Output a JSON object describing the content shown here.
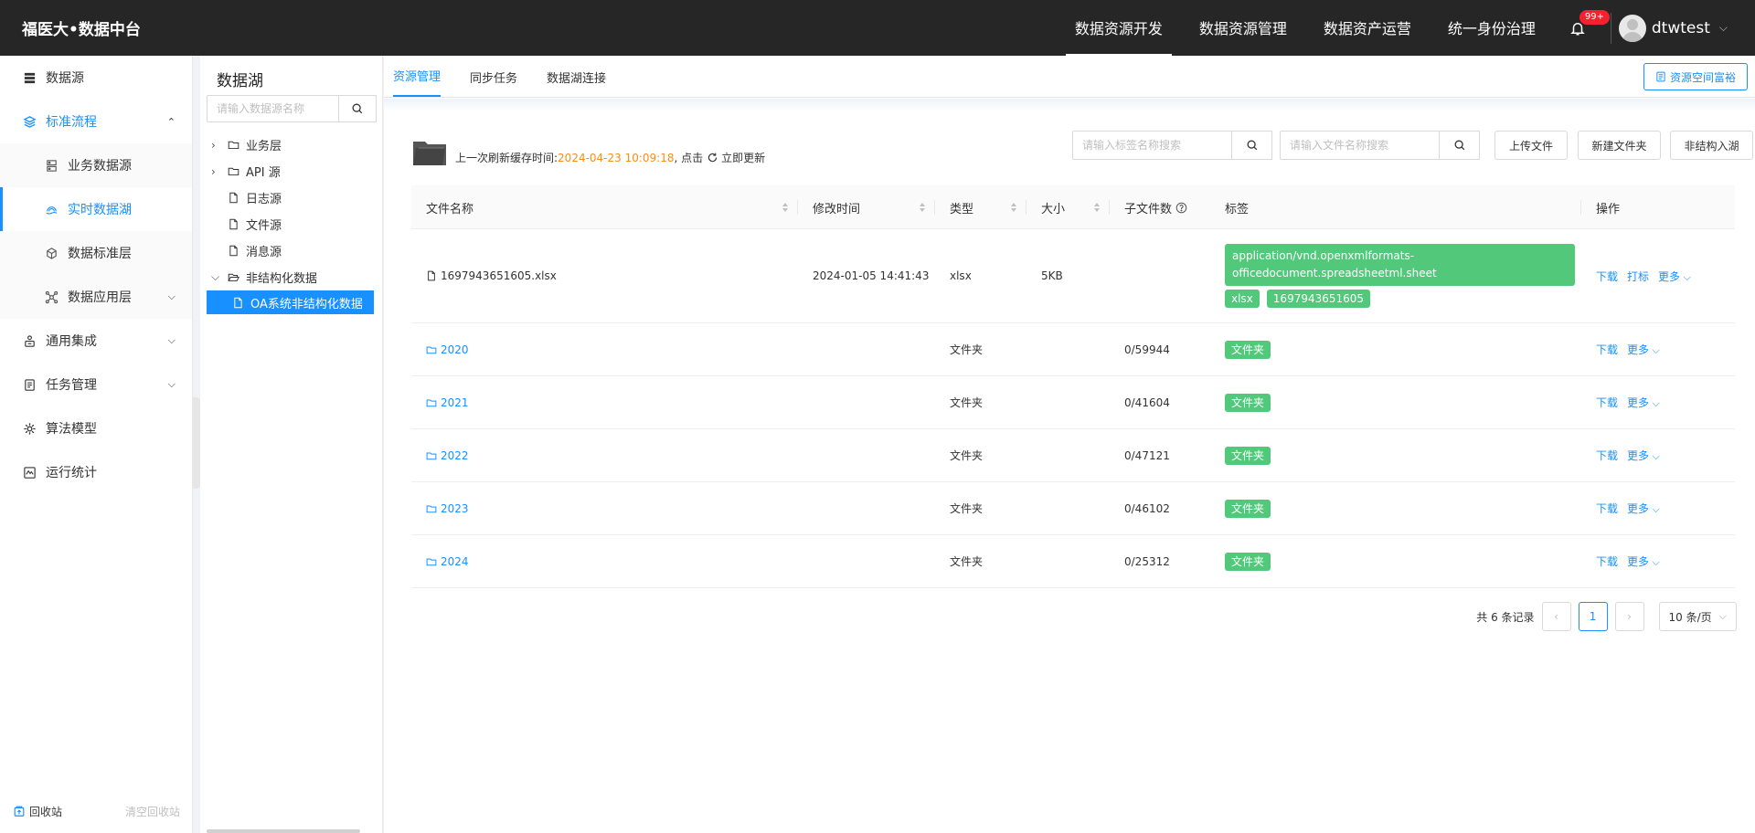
{
  "app": {
    "logo": "福医大•数据中台"
  },
  "topnav": {
    "items": [
      "数据资源开发",
      "数据资源管理",
      "数据资产运营",
      "统一身份治理"
    ],
    "active_index": 0,
    "notification_count": "99+",
    "username": "dtwtest"
  },
  "sidebar": {
    "items": [
      {
        "label": "数据源",
        "icon": "database-icon"
      },
      {
        "label": "标准流程",
        "icon": "layers-icon",
        "open": true
      },
      {
        "label": "业务数据源",
        "icon": "server-icon",
        "sub": true
      },
      {
        "label": "实时数据湖",
        "icon": "lake-icon",
        "sub": true,
        "selected": true
      },
      {
        "label": "数据标准层",
        "icon": "cube-icon",
        "sub": true
      },
      {
        "label": "数据应用层",
        "icon": "cluster-icon",
        "sub": true,
        "has_arrow": true
      },
      {
        "label": "通用集成",
        "icon": "integration-icon",
        "has_arrow": true
      },
      {
        "label": "任务管理",
        "icon": "task-icon",
        "has_arrow": true
      },
      {
        "label": "算法模型",
        "icon": "gear-icon"
      },
      {
        "label": "运行统计",
        "icon": "stats-icon"
      }
    ],
    "footer": {
      "recycle": "回收站",
      "clear": "清空回收站"
    }
  },
  "tree": {
    "title": "数据湖",
    "search_placeholder": "请输入数据源名称",
    "nodes": [
      {
        "label": "业务层",
        "type": "folder",
        "caret": "collapsed"
      },
      {
        "label": "API 源",
        "type": "folder",
        "caret": "collapsed"
      },
      {
        "label": "日志源",
        "type": "file"
      },
      {
        "label": "文件源",
        "type": "file"
      },
      {
        "label": "消息源",
        "type": "file"
      },
      {
        "label": "非结构化数据",
        "type": "folder-open",
        "caret": "expanded"
      },
      {
        "label": "OA系统非结构化数据",
        "type": "file",
        "child": true,
        "selected": true
      }
    ]
  },
  "tabs": {
    "items": [
      "资源管理",
      "同步任务",
      "数据湖连接"
    ],
    "active_index": 0,
    "rich_button": "资源空间富裕"
  },
  "toolbar": {
    "refresh_prefix": "上一次刷新缓存时间:",
    "refresh_time": "2024-04-23 10:09:18",
    "refresh_mid": ", 点击",
    "refresh_link": "立即更新",
    "tag_search_placeholder": "请输入标签名称搜索",
    "file_search_placeholder": "请输入文件名称搜索",
    "upload": "上传文件",
    "new_folder": "新建文件夹",
    "unstructured_in": "非结构入湖"
  },
  "table": {
    "columns": [
      "文件名称",
      "修改时间",
      "类型",
      "大小",
      "子文件数",
      "标签",
      "操作"
    ],
    "rows": [
      {
        "name": "1697943651605.xlsx",
        "kind": "file",
        "modified": "2024-01-05 14:41:43",
        "type": "xlsx",
        "size": "5KB",
        "children": "",
        "tags": [
          "application/vnd.openxmlformats-officedocument.spreadsheetml.sheet",
          "xlsx",
          "1697943651605"
        ],
        "ops": [
          "下载",
          "打标",
          "更多"
        ]
      },
      {
        "name": "2020",
        "kind": "folder",
        "modified": "",
        "type": "文件夹",
        "size": "",
        "children": "0/59944",
        "tags": [
          "文件夹"
        ],
        "ops": [
          "下载",
          "更多"
        ]
      },
      {
        "name": "2021",
        "kind": "folder",
        "modified": "",
        "type": "文件夹",
        "size": "",
        "children": "0/41604",
        "tags": [
          "文件夹"
        ],
        "ops": [
          "下载",
          "更多"
        ]
      },
      {
        "name": "2022",
        "kind": "folder",
        "modified": "",
        "type": "文件夹",
        "size": "",
        "children": "0/47121",
        "tags": [
          "文件夹"
        ],
        "ops": [
          "下载",
          "更多"
        ]
      },
      {
        "name": "2023",
        "kind": "folder",
        "modified": "",
        "type": "文件夹",
        "size": "",
        "children": "0/46102",
        "tags": [
          "文件夹"
        ],
        "ops": [
          "下载",
          "更多"
        ]
      },
      {
        "name": "2024",
        "kind": "folder",
        "modified": "",
        "type": "文件夹",
        "size": "",
        "children": "0/25312",
        "tags": [
          "文件夹"
        ],
        "ops": [
          "下载",
          "更多"
        ]
      }
    ]
  },
  "pagination": {
    "total_text": "共 6 条记录",
    "current_page": "1",
    "page_size": "10 条/页"
  },
  "colors": {
    "primary": "#1890ff",
    "tag_green": "#52c97a",
    "highlight_orange": "#fa8c16",
    "topbar": "#262626"
  }
}
